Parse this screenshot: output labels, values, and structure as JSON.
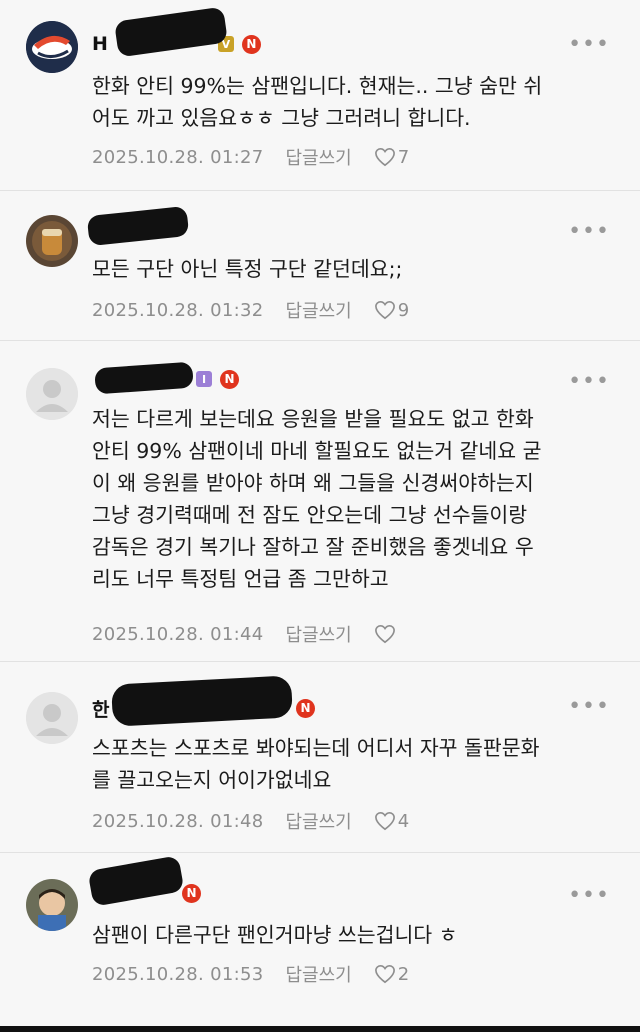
{
  "comments": [
    {
      "name": "H",
      "badges": [
        "V",
        "N"
      ],
      "text": "한화 안티 99%는 삼팬입니다. 현재는.. 그냥 숨만 쉬\n어도 까고 있음요ㅎㅎ 그냥 그러려니 합니다.",
      "date": "2025.10.28. 01:27",
      "reply": "답글쓰기",
      "likes": "7",
      "avatar": "team-logo"
    },
    {
      "name": "",
      "badges": [],
      "text": "모든 구단 아닌 특정 구단 같던데요;;",
      "date": "2025.10.28. 01:32",
      "reply": "답글쓰기",
      "likes": "9",
      "avatar": "photo-drink"
    },
    {
      "name": "",
      "badges": [
        "I",
        "N"
      ],
      "text": "저는 다르게 보는데요 응원을 받을 필요도 없고 한화\n안티 99% 삼팬이네 마네 할필요도 없는거 같네요 굳\n이 왜 응원를 받아야 하며 왜 그들을 신경써야하는지\n그냥 경기력때메 전 잠도 안오는데 그냥 선수들이랑\n감독은 경기 복기나 잘하고 잘 준비했음 좋겟네요 우\n리도 너무 특정팀 언급 좀 그만하고",
      "date": "2025.10.28. 01:44",
      "reply": "답글쓰기",
      "likes": "",
      "avatar": "default"
    },
    {
      "name": "한",
      "badges": [
        "N"
      ],
      "text": "스포츠는 스포츠로 봐야되는데 어디서 자꾸 돌판문화\n를 끌고오는지 어이가없네요",
      "date": "2025.10.28. 01:48",
      "reply": "답글쓰기",
      "likes": "4",
      "avatar": "default"
    },
    {
      "name": "",
      "badges": [
        "N"
      ],
      "text": "삼팬이 다른구단 팬인거마냥 쓰는겁니다 ㅎ",
      "date": "2025.10.28. 01:53",
      "reply": "답글쓰기",
      "likes": "2",
      "avatar": "photo-child"
    }
  ],
  "more_icon": "more-horizontal-icon",
  "colors": {
    "badge_n": "#e0341e",
    "badge_v": "#c9a227",
    "badge_i": "#9c7fd6",
    "meta": "#8e8e8e"
  }
}
